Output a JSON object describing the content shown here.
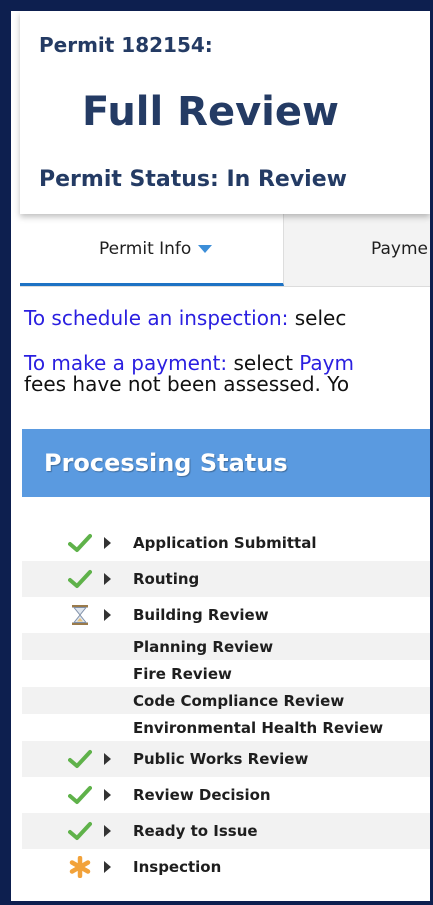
{
  "header": {
    "permit_id": "Permit 182154:",
    "title": "Full Review",
    "status": "Permit Status: In Review"
  },
  "tabs": [
    {
      "label": "Permit Info",
      "active": true
    },
    {
      "label": "Payme",
      "active": false
    }
  ],
  "info": {
    "line1_link": "To schedule an inspection:",
    "line1_rest": " selec",
    "line2_link": "To make a payment:",
    "line2_mid": " select ",
    "line2_link2": "Paym",
    "line3": "fees have not been assessed.  Yo"
  },
  "processing": {
    "title": "Processing Status",
    "items": [
      {
        "label": "Application Submittal",
        "icon": "check-icon"
      },
      {
        "label": "Routing",
        "icon": "check-icon"
      },
      {
        "label": "Building Review",
        "icon": "hourglass-icon"
      },
      {
        "label": "Planning Review",
        "icon": ""
      },
      {
        "label": "Fire Review",
        "icon": ""
      },
      {
        "label": "Code Compliance Review",
        "icon": ""
      },
      {
        "label": "Environmental Health Review",
        "icon": ""
      },
      {
        "label": "Public Works Review",
        "icon": "check-icon"
      },
      {
        "label": "Review Decision",
        "icon": "check-icon"
      },
      {
        "label": "Ready to Issue",
        "icon": "check-icon"
      },
      {
        "label": "Inspection",
        "icon": "asterisk-icon"
      }
    ]
  },
  "colors": {
    "frame": "#0d1f4f",
    "heading": "#243b64",
    "link": "#2a1fe0",
    "section_header": "#5a9ae0",
    "tab_underline": "#1d72c4",
    "check": "#5fb24a",
    "asterisk": "#f2a23a"
  }
}
